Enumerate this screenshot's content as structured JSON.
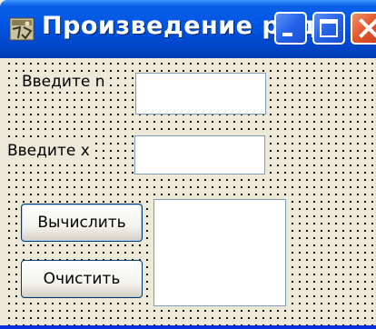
{
  "window": {
    "title": "Произведение ряда",
    "controls": {
      "minimize_icon": "minimize-icon",
      "maximize_icon": "maximize-icon",
      "close_icon": "close-icon"
    }
  },
  "form": {
    "n_label": "Введите n",
    "n_value": "",
    "x_label": "Введите x",
    "x_value": "",
    "compute_button": "Вычислить",
    "clear_button": "Очистить",
    "output_value": ""
  },
  "colors": {
    "titlebar": "#0054e3",
    "form_background": "#ece9d8",
    "close_button": "#e3582d",
    "edit_border": "#7f9db9"
  }
}
